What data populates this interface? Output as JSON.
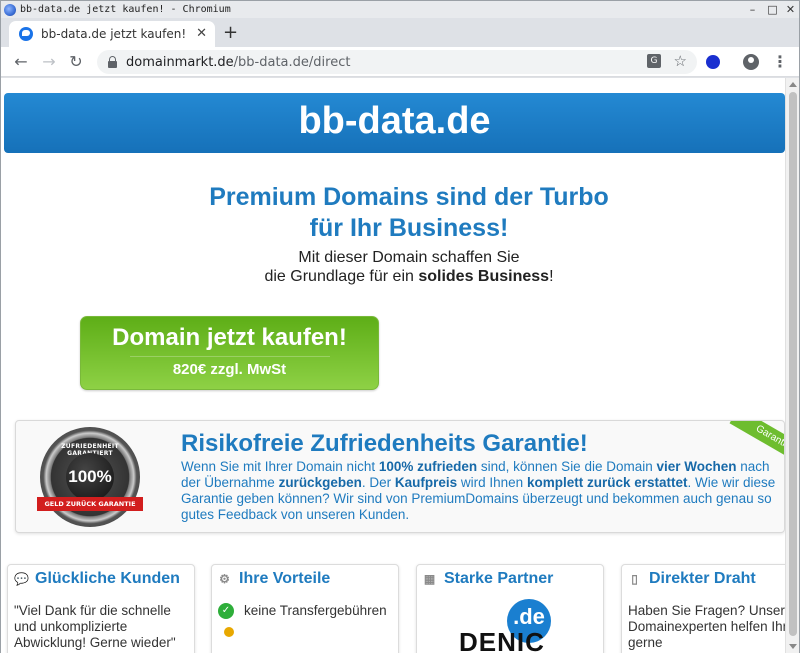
{
  "window": {
    "title": "bb-data.de jetzt kaufen! - Chromium",
    "controls": {
      "minimize": "–",
      "maximize": "□",
      "close": "✕"
    }
  },
  "tabs": [
    {
      "title": "bb-data.de jetzt kaufen!",
      "close": "✕",
      "active": true
    }
  ],
  "new_tab_label": "+",
  "toolbar": {
    "back_icon": "←",
    "forward_icon": "→",
    "reload_icon": "↻",
    "url_host": "domainmarkt.de",
    "url_path": "/bb-data.de/direct",
    "translate_icon": "G",
    "bookmark_icon": "☆",
    "menu_icon": "⋮"
  },
  "page": {
    "header": "bb-data.de",
    "hero": {
      "title_line1": "Premium Domains sind der Turbo",
      "title_line2": "für Ihr Business!",
      "sub_line1": "Mit dieser Domain schaffen Sie",
      "sub_line2_pre": "die Grundlage für ein ",
      "sub_line2_bold": "solides Business",
      "sub_line2_post": "!"
    },
    "buy_button": {
      "label": "Domain jetzt kaufen!",
      "price": "820€ zzgl. MwSt"
    },
    "guarantee": {
      "badge_ring": "ZUFRIEDENHEIT GARANTIERT",
      "badge_percent": "100%",
      "badge_ribbon": "GELD ZURÜCK GARANTIE",
      "corner": "Garantie",
      "title": "Risikofreie Zufriedenheits Garantie!",
      "t1": "Wenn Sie mit Ihrer Domain nicht ",
      "b1": "100% zufrieden",
      "t2": " sind, können Sie die Domain ",
      "b2": "vier Wochen",
      "t3": " nach der Übernahme ",
      "b3": "zurückgeben",
      "t4": ". Der ",
      "b4": "Kaufpreis",
      "t5": " wird Ihnen ",
      "b5": "komplett zurück erstattet",
      "t6": ". Wie wir diese Garantie geben können? Wir sind von PremiumDomains überzeugt und bekommen auch genau so gutes Feedback von unseren Kunden."
    },
    "cards": [
      {
        "title": "Glückliche Kunden",
        "icon": "speech-bubble-icon",
        "body": "\"Viel Dank für die schnelle und unkomplizierte Abwicklung! Gerne wieder\""
      },
      {
        "title": "Ihre Vorteile",
        "icon": "gears-icon",
        "body": "keine Transfergebühren"
      },
      {
        "title": "Starke Partner",
        "icon": "handshake-icon",
        "logo_text": "DENIC",
        "logo_badge": ".de"
      },
      {
        "title": "Direkter Draht",
        "icon": "phone-icon",
        "body": "Haben Sie Fragen? Unser Domainexperten helfen Ihnen gerne"
      }
    ]
  }
}
